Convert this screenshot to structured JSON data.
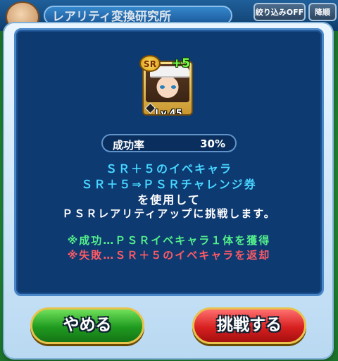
{
  "topbar": {
    "title": "レアリティ変換研究所",
    "filter_label": "絞り込みOFF",
    "sort_label": "降順"
  },
  "card": {
    "rarity": "SR",
    "plus": "+5",
    "level": "Lv.45"
  },
  "rate": {
    "label": "成功率",
    "value": "30%"
  },
  "message": {
    "line1": "ＳＲ＋５のイベキャラ",
    "line2": "ＳＲ＋５⇒ＰＳＲチャレンジ券",
    "line3": "を使用して",
    "line4": "ＰＳＲレアリティアップに挑戦します。",
    "success": "※成功…ＰＳＲイベキャラ１体を獲得",
    "failure": "※失敗…ＳＲ＋５のイベキャラを返却"
  },
  "buttons": {
    "cancel": "やめる",
    "challenge": "挑戦する"
  },
  "colors": {
    "panel": "#0e3a72",
    "cyan_text": "#47d6ff",
    "success_text": "#54f08a",
    "failure_text": "#ff5a64",
    "cancel_button": "#1f9a1f",
    "challenge_button": "#d82020"
  }
}
